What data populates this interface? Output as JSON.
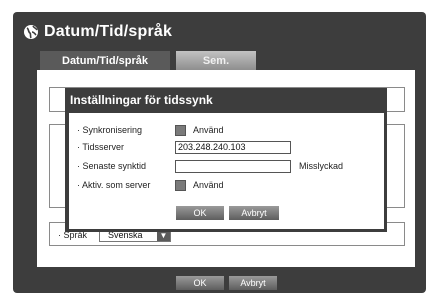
{
  "window": {
    "title": "Datum/Tid/språk",
    "tabs": [
      {
        "label": "Datum/Tid/språk",
        "active": true
      },
      {
        "label": "Sem.",
        "active": false
      }
    ],
    "language": {
      "label": "· Språk",
      "value": "Svenska"
    },
    "ok_label": "OK",
    "cancel_label": "Avbryt"
  },
  "dialog": {
    "title": "Inställningar för tidssynk",
    "rows": {
      "sync": {
        "label": "· Synkronisering",
        "checkbox_label": "Använd"
      },
      "server": {
        "label": "· Tidsserver",
        "value": "203.248.240.103"
      },
      "last_sync": {
        "label": "· Senaste synktid",
        "value": "",
        "status": "Misslyckad"
      },
      "as_server": {
        "label": "· Aktiv. som server",
        "checkbox_label": "Använd"
      }
    },
    "ok_label": "OK",
    "cancel_label": "Avbryt"
  },
  "colors": {
    "frame": "#3d3d3d",
    "active_tab": "#5a5a5a",
    "button": "#7a7a7a"
  }
}
